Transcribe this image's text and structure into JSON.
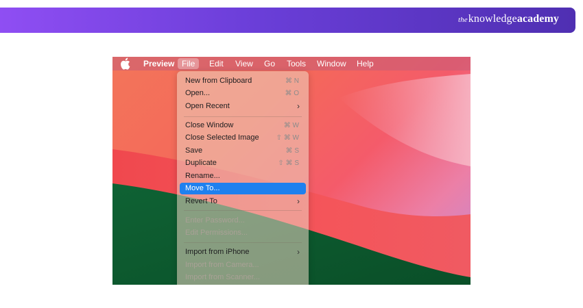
{
  "brand": {
    "logo_the": "the",
    "logo_knowledge": "knowledge",
    "logo_academy": "academy"
  },
  "menubar": {
    "apple_icon": "apple-icon",
    "app_name": "Preview",
    "menus": [
      "File",
      "Edit",
      "View",
      "Go",
      "Tools",
      "Window",
      "Help"
    ],
    "active_menu": "File"
  },
  "file_menu": {
    "items": [
      {
        "label": "New from Clipboard",
        "shortcut": "⌘ N",
        "enabled": true
      },
      {
        "label": "Open...",
        "shortcut": "⌘ O",
        "enabled": true
      },
      {
        "label": "Open Recent",
        "submenu": true,
        "enabled": true
      },
      {
        "label": "Close Window",
        "shortcut": "⌘ W",
        "enabled": true
      },
      {
        "label": "Close Selected Image",
        "shortcut": "⇧ ⌘ W",
        "enabled": true
      },
      {
        "label": "Save",
        "shortcut": "⌘ S",
        "enabled": true
      },
      {
        "label": "Duplicate",
        "shortcut": "⇧ ⌘ S",
        "enabled": true
      },
      {
        "label": "Rename...",
        "enabled": true
      },
      {
        "label": "Move To...",
        "enabled": true,
        "selected": true
      },
      {
        "label": "Revert To",
        "submenu": true,
        "enabled": true
      },
      {
        "label": "Enter Password...",
        "enabled": false
      },
      {
        "label": "Edit Permissions...",
        "enabled": false
      },
      {
        "label": "Import from iPhone",
        "submenu": true,
        "enabled": true
      },
      {
        "label": "Import from Camera...",
        "enabled": false
      },
      {
        "label": "Import from Scanner...",
        "enabled": false
      }
    ]
  },
  "colors": {
    "brand_gradient_start": "#8f4ef3",
    "brand_gradient_end": "#4f2fb2",
    "selection_blue": "#1f80ee"
  }
}
